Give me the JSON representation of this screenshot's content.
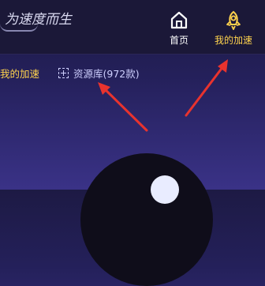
{
  "header": {
    "logo_text": "为速度而生",
    "nav": [
      {
        "label": "首页",
        "icon": "home-icon"
      },
      {
        "label": "我的加速",
        "icon": "rocket-icon"
      }
    ]
  },
  "subnav": {
    "my_speed_label": "我的加速",
    "resource_label": "资源库(972款)"
  },
  "colors": {
    "accent": "#ffd34d",
    "arrow": "#e8332e",
    "background": "#24205a"
  }
}
